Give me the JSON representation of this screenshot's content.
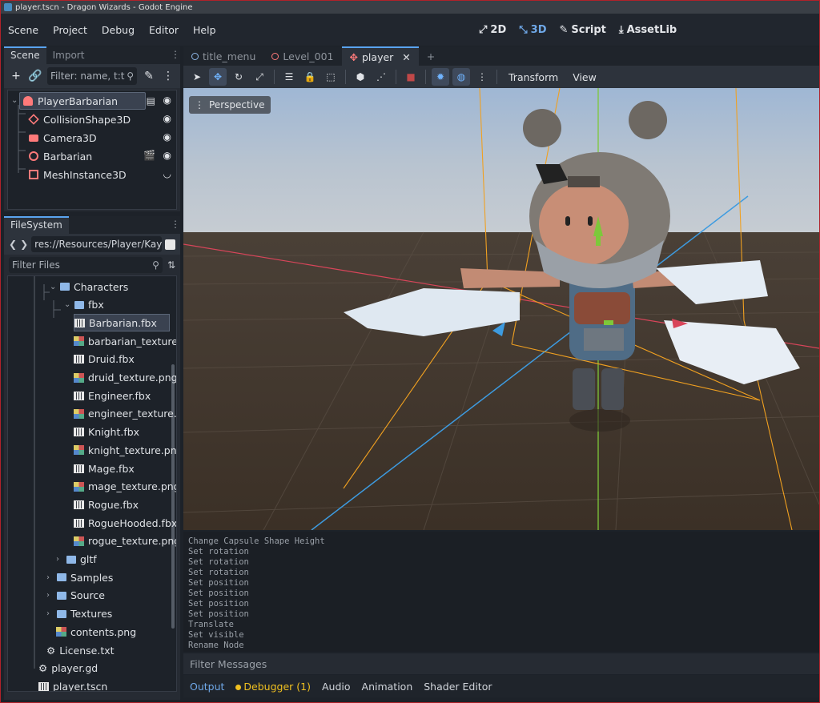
{
  "window": {
    "title": "player.tscn - Dragon Wizards - Godot Engine"
  },
  "menu": [
    "Scene",
    "Project",
    "Debug",
    "Editor",
    "Help"
  ],
  "workspaces": [
    {
      "label": "2D",
      "icon": "2d-icon"
    },
    {
      "label": "3D",
      "icon": "3d-icon"
    },
    {
      "label": "Script",
      "icon": "script-icon"
    },
    {
      "label": "AssetLib",
      "icon": "assetlib-icon"
    }
  ],
  "scene_dock": {
    "tabs": [
      "Scene",
      "Import"
    ],
    "filter_placeholder": "Filter: name, t:t",
    "nodes": [
      {
        "label": "PlayerBarbarian",
        "icon": "character-body-icon",
        "color": "#ff7a7a"
      },
      {
        "label": "CollisionShape3D",
        "icon": "collision-shape-icon",
        "color": "#ff7a7a"
      },
      {
        "label": "Camera3D",
        "icon": "camera-icon",
        "color": "#ff7a7a"
      },
      {
        "label": "Barbarian",
        "icon": "node3d-icon",
        "color": "#ff7a7a"
      },
      {
        "label": "MeshInstance3D",
        "icon": "mesh-instance-icon",
        "color": "#ff7a7a"
      }
    ]
  },
  "filesystem": {
    "tab": "FileSystem",
    "path": "res://Resources/Player/Kay",
    "filter_placeholder": "Filter Files",
    "items": [
      {
        "label": "Characters",
        "type": "folder"
      },
      {
        "label": "fbx",
        "type": "folder"
      },
      {
        "label": "Barbarian.fbx",
        "type": "scene"
      },
      {
        "label": "barbarian_texture...",
        "type": "texture"
      },
      {
        "label": "Druid.fbx",
        "type": "scene"
      },
      {
        "label": "druid_texture.png",
        "type": "texture"
      },
      {
        "label": "Engineer.fbx",
        "type": "scene"
      },
      {
        "label": "engineer_texture....",
        "type": "texture"
      },
      {
        "label": "Knight.fbx",
        "type": "scene"
      },
      {
        "label": "knight_texture.png",
        "type": "texture"
      },
      {
        "label": "Mage.fbx",
        "type": "scene"
      },
      {
        "label": "mage_texture.png",
        "type": "texture"
      },
      {
        "label": "Rogue.fbx",
        "type": "scene"
      },
      {
        "label": "RogueHooded.fbx",
        "type": "scene"
      },
      {
        "label": "rogue_texture.png",
        "type": "texture"
      },
      {
        "label": "gltf",
        "type": "folder"
      },
      {
        "label": "Samples",
        "type": "folder"
      },
      {
        "label": "Source",
        "type": "folder"
      },
      {
        "label": "Textures",
        "type": "folder"
      },
      {
        "label": "contents.png",
        "type": "image"
      },
      {
        "label": "License.txt",
        "type": "text"
      },
      {
        "label": "player.gd",
        "type": "script"
      },
      {
        "label": "player.tscn",
        "type": "scene"
      }
    ]
  },
  "scene_tabs": [
    "title_menu",
    "Level_001",
    "player"
  ],
  "viewport_menus": {
    "transform": "Transform",
    "view": "View"
  },
  "viewport_label": "Perspective",
  "output_lines": [
    "Change Capsule Shape Height",
    "Set rotation",
    "Set rotation",
    "Set rotation",
    "Set position",
    "Set position",
    "Set position",
    "Set position",
    "Translate",
    "Set visible",
    "Rename Node"
  ],
  "filter_messages": "Filter Messages",
  "bottom_tabs": [
    "Output",
    "Debugger (1)",
    "Audio",
    "Animation",
    "Shader Editor"
  ],
  "colors": {
    "accent": "#5aa4f0",
    "frame": "#b0222a",
    "bg": "#1d2229"
  }
}
